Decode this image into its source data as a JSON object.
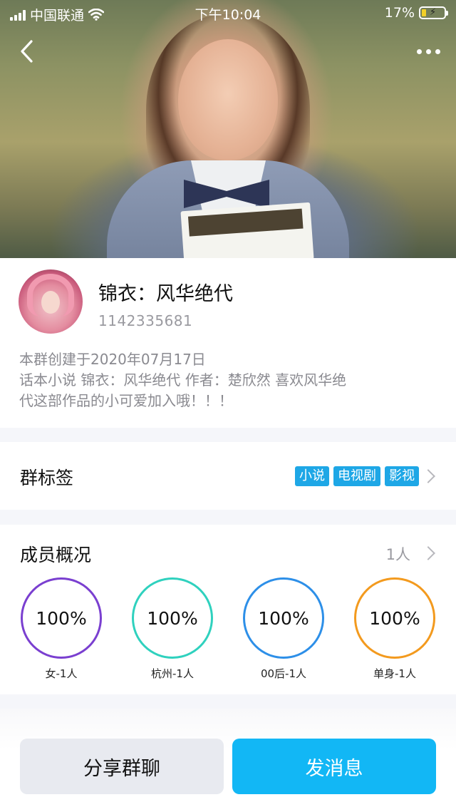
{
  "status_bar": {
    "carrier": "中国联通",
    "time": "下午10:04",
    "battery": "17%"
  },
  "cover": {
    "back_icon": "chevron-left-icon",
    "more_icon": "ellipsis-icon"
  },
  "group": {
    "name": "锦衣：风华绝代",
    "id": "1142335681",
    "description_lines": [
      "本群创建于2020年07月17日",
      "话本小说 锦衣：风华绝代  作者：楚欣然 喜欢风华绝",
      "代这部作品的小可爱加入哦！！！"
    ]
  },
  "tags_section": {
    "title": "群标签",
    "tags": [
      "小说",
      "电视剧",
      "影视"
    ]
  },
  "members_section": {
    "title": "成员概况",
    "count": "1人",
    "stats": [
      {
        "value": "100%",
        "label": "女-1人",
        "color": "#7a3fd0"
      },
      {
        "value": "100%",
        "label": "杭州-1人",
        "color": "#2fd1be"
      },
      {
        "value": "100%",
        "label": "00后-1人",
        "color": "#2d8fe8"
      },
      {
        "value": "100%",
        "label": "单身-1人",
        "color": "#f39a1e"
      }
    ]
  },
  "actions": {
    "share_label": "分享群聊",
    "send_label": "发消息"
  },
  "colors": {
    "accent": "#12b7f5",
    "tag": "#1ea7e6"
  }
}
